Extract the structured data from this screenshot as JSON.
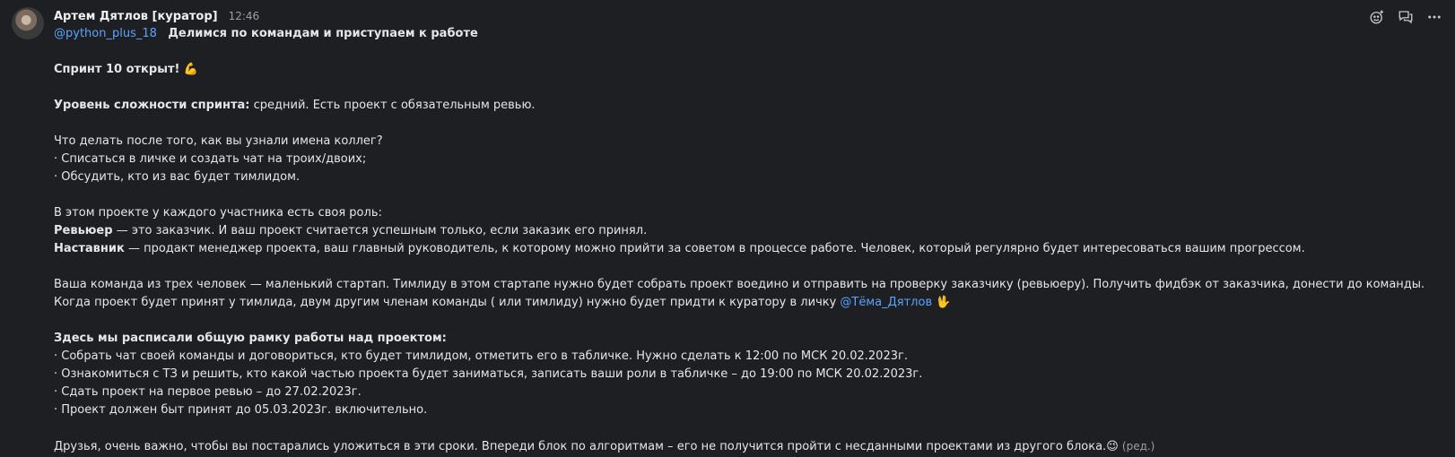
{
  "message": {
    "author": "Артем Дятлов [куратор]",
    "time": "12:46",
    "mention_channel": "@python_plus_18",
    "subject": "Делимся по командам и приступаем к работе",
    "sprint_title": "Спринт 10 открыт!",
    "sprint_emoji": "💪",
    "difficulty_label": "Уровень сложности спринта:",
    "difficulty_text": " средний. Есть проект с обязательным ревью.",
    "what_to_do_q": "Что делать после того, как вы узнали имена коллег?",
    "step1": "· Списаться в личке и создать чат на троих/двоих;",
    "step2": "· Обсудить, кто из вас будет тимлидом.",
    "roles_intro": "В этом проекте у каждого участника есть своя роль:",
    "reviewer_label": "Ревьюер",
    "reviewer_text": " — это заказчик. И ваш проект считается успешным только, если заказик его принял.",
    "mentor_label": "Наставник",
    "mentor_text": " — продакт менеджер проекта, ваш главный руководитель, к которому можно прийти за советом в процессе работе. Человек, который регулярно будет интересоваться вашим прогрессом.",
    "team_line1": "Ваша команда из трех человек — маленький стартап. Тимлиду в этом стартапе нужно будет собрать проект воедино и отправить на проверку заказчику (ревьюеру). Получить фидбэк от заказчика, донести до команды.",
    "team_line2": "Когда проект будет принят у тимлида, двум другим членам команды ( или тимлиду) нужно будет придти к куратору в личку ",
    "curator_mention": "@Тёма_Дятлов",
    "wave_emoji": "🖖",
    "frame_title": "Здесь мы расписали общую рамку работы над проектом:",
    "frame1": "· Собрать чат своей команды и договориться, кто будет тимлидом, отметить его в табличке. Нужно сделать к 12:00 по МСК 20.02.2023г.",
    "frame2": "· Ознакомиться с ТЗ и решить, кто какой частью проекта будет заниматься, записать ваши роли в табличке – до 19:00 по МСК 20.02.2023г.",
    "frame3": "· Сдать проект на первое ревью – до 27.02.2023г.",
    "frame4": "· Проект должен быт принят до 05.03.2023г. включительно.",
    "final": "Друзья, очень важно, чтобы вы постарались уложиться в эти сроки. Впереди блок по алгоритмам – его не получится пройти с несданными проектами из другого блока.",
    "wink_emoji": "😉",
    "edited": "(ред.)"
  },
  "actions": {
    "icons": [
      "add-reaction-icon",
      "reply-thread-icon",
      "more-icon"
    ]
  }
}
